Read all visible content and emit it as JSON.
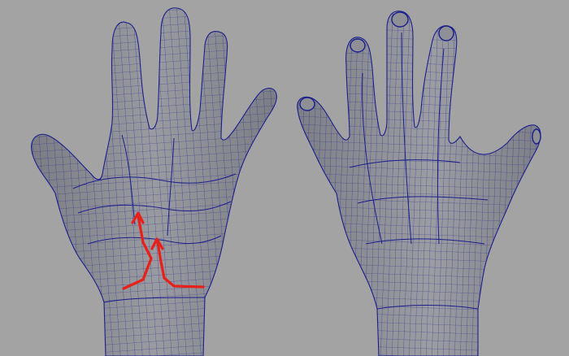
{
  "scene": {
    "background_color": "#a3a3a3",
    "mesh_fill_color": "#8f9096",
    "mesh_shade_color": "#7c7d84",
    "wire_color": "#1a1f8c",
    "highlight_color": "#e8201a"
  },
  "models": [
    {
      "name": "palm-view",
      "view": "palm",
      "edge_loop_annotations": 2
    },
    {
      "name": "back-view",
      "view": "dorsal",
      "open_finger_tips": 4
    }
  ]
}
